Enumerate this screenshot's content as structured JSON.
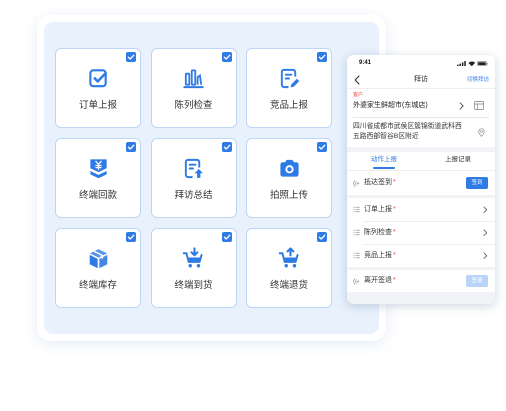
{
  "colors": {
    "accent": "#2f7be6",
    "panel_bg": "#e8f1fc",
    "tile_border": "#bdd6f5",
    "required": "#f04b3a",
    "disabled_button": "#b9d4f8"
  },
  "features": [
    {
      "label": "订单上报",
      "icon": "clipboard-check-icon",
      "checked": true
    },
    {
      "label": "陈列检查",
      "icon": "bar-chart-icon",
      "checked": true
    },
    {
      "label": "竞品上报",
      "icon": "document-edit-icon",
      "checked": true
    },
    {
      "label": "终端回款",
      "icon": "yuan-download-icon",
      "checked": true
    },
    {
      "label": "拜访总结",
      "icon": "document-upload-icon",
      "checked": true
    },
    {
      "label": "拍照上传",
      "icon": "camera-icon",
      "checked": true
    },
    {
      "label": "终端库存",
      "icon": "package-box-icon",
      "checked": true
    },
    {
      "label": "终端到货",
      "icon": "cart-arrival-icon",
      "checked": true
    },
    {
      "label": "终端退货",
      "icon": "cart-return-icon",
      "checked": true
    }
  ],
  "phone": {
    "status_bar": {
      "time": "9:41",
      "icons": [
        "signal-icon",
        "wifi-icon",
        "battery-icon"
      ]
    },
    "header": {
      "back_icon": "back-icon",
      "title": "拜访",
      "action": "切换拜访"
    },
    "customer": {
      "tag": "客户",
      "name": "外婆家生鲜超市(东城店)",
      "chevron_icon": "chevron-right-icon",
      "store_icon": "store-icon"
    },
    "address": {
      "text": "四川省成都市武侯区簇锦街道武科西五路西部智谷B区附近",
      "icon": "location-pin-icon"
    },
    "tabs": [
      {
        "label": "动作上报",
        "active": true
      },
      {
        "label": "上报记录",
        "active": false
      }
    ],
    "actions": [
      {
        "label": "抵达签到",
        "required": "*",
        "icon": "checkin-icon",
        "button": "签到",
        "button_disabled": false
      },
      {
        "label": "订单上报",
        "required": "*",
        "icon": "list-icon"
      },
      {
        "label": "陈列检查",
        "required": "*",
        "icon": "list-icon"
      },
      {
        "label": "竞品上报",
        "required": "*",
        "icon": "list-icon"
      },
      {
        "label": "离开签退",
        "required": "*",
        "icon": "checkout-icon",
        "button": "签退",
        "button_disabled": true
      }
    ]
  }
}
